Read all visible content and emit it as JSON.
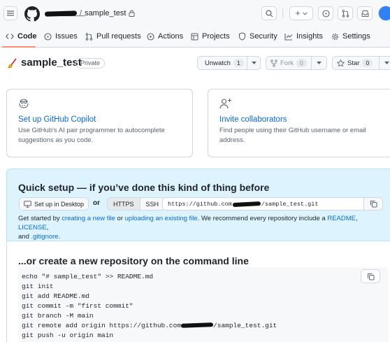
{
  "header": {
    "owner_label": "__________",
    "separator": "/",
    "repo_label": "sample_test",
    "plus_label": "+"
  },
  "tabs": [
    {
      "label": "Code",
      "icon": "code-icon"
    },
    {
      "label": "Issues",
      "icon": "issue-icon"
    },
    {
      "label": "Pull requests",
      "icon": "pull-request-icon"
    },
    {
      "label": "Actions",
      "icon": "play-icon"
    },
    {
      "label": "Projects",
      "icon": "table-icon"
    },
    {
      "label": "Security",
      "icon": "shield-icon"
    },
    {
      "label": "Insights",
      "icon": "graph-icon"
    },
    {
      "label": "Settings",
      "icon": "gear-icon"
    }
  ],
  "repo": {
    "name": "sample_test",
    "visibility": "Private",
    "unwatch_label": "Unwatch",
    "watch_count": "1",
    "fork_label": "Fork",
    "fork_count": "0",
    "star_label": "Star",
    "star_count": "0"
  },
  "cards": [
    {
      "icon": "copilot-icon",
      "title": "Set up GitHub Copilot",
      "description": "Use GitHub's AI pair programmer to autocomplete suggestions as you code."
    },
    {
      "icon": "person-add-icon",
      "title": "Invite collaborators",
      "description": "Find people using their GitHub username or email address."
    }
  ],
  "quick_setup": {
    "title": "Quick setup — if you’ve done this kind of thing before",
    "desktop_button": "Set up in Desktop",
    "or_label": "or",
    "https_label": "HTTPS",
    "ssh_label": "SSH",
    "url_prefix": "https://github.com",
    "url_suffix": "/sample_test.git",
    "help": {
      "t1": "Get started by ",
      "l1": "creating a new file",
      "t2": " or ",
      "l2": "uploading an existing file",
      "t3": ". We recommend every repository include a ",
      "l3": "README",
      "t4": ", ",
      "l4": "LICENSE",
      "t5": ",",
      "t6": "and ",
      "l5": ".gitignore",
      "t7": "."
    }
  },
  "command_line": {
    "title": "...or create a new repository on the command line",
    "lines": [
      "echo \"# sample_test\" >> README.md",
      "git init",
      "git add README.md",
      "git commit -m \"first commit\"",
      "git branch -M main"
    ],
    "remote_prefix": "git remote add origin https://github.com",
    "remote_suffix": "/sample_test.git",
    "push_line": "git push -u origin main"
  },
  "colors": {
    "link": "#0969da",
    "tab_underline": "#fd8c73",
    "quick_setup_bg": "#ddf4ff",
    "border": "#d0d7de"
  }
}
